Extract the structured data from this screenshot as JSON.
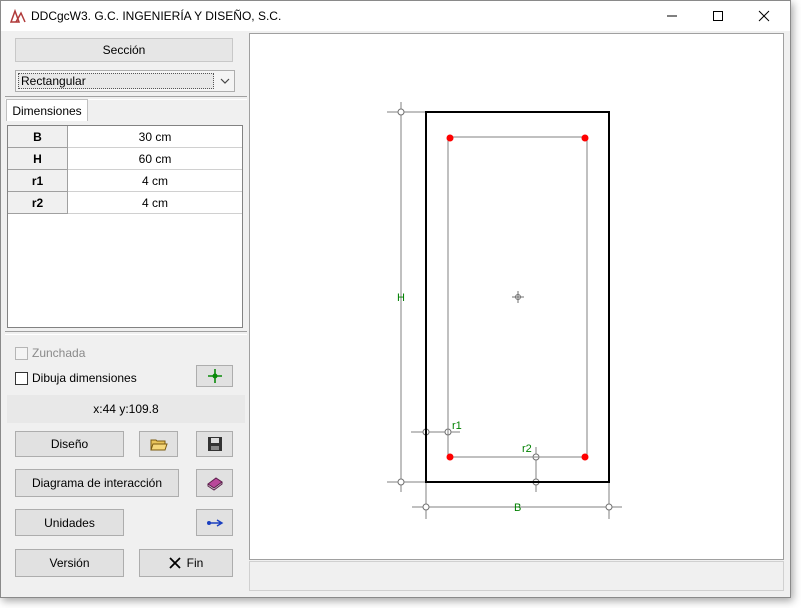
{
  "window": {
    "title": "DDCgcW3. G.C. INGENIERÍA Y DISEÑO, S.C."
  },
  "left_panel": {
    "section_label": "Sección",
    "section_type": {
      "selected": "Rectangular"
    },
    "tab_label": "Dimensiones",
    "dimensions": [
      {
        "name": "B",
        "value": "30 cm"
      },
      {
        "name": "H",
        "value": "60 cm"
      },
      {
        "name": "r1",
        "value": "4 cm"
      },
      {
        "name": "r2",
        "value": "4 cm"
      }
    ],
    "zunchada_label": "Zunchada",
    "dibuja_label": "Dibuja dimensiones",
    "coordinates": "x:44 y:109.8",
    "buttons": {
      "diseno": "Diseño",
      "diagrama": "Diagrama de interacción",
      "unidades": "Unidades",
      "version": "Versión",
      "fin": "Fin"
    }
  },
  "drawing": {
    "labels": {
      "h": "H",
      "b": "B",
      "r1": "r1",
      "r2": "r2"
    }
  },
  "colors": {
    "rebar": "#ff0000",
    "dimension_text": "#008000",
    "section_outline": "#000000"
  }
}
